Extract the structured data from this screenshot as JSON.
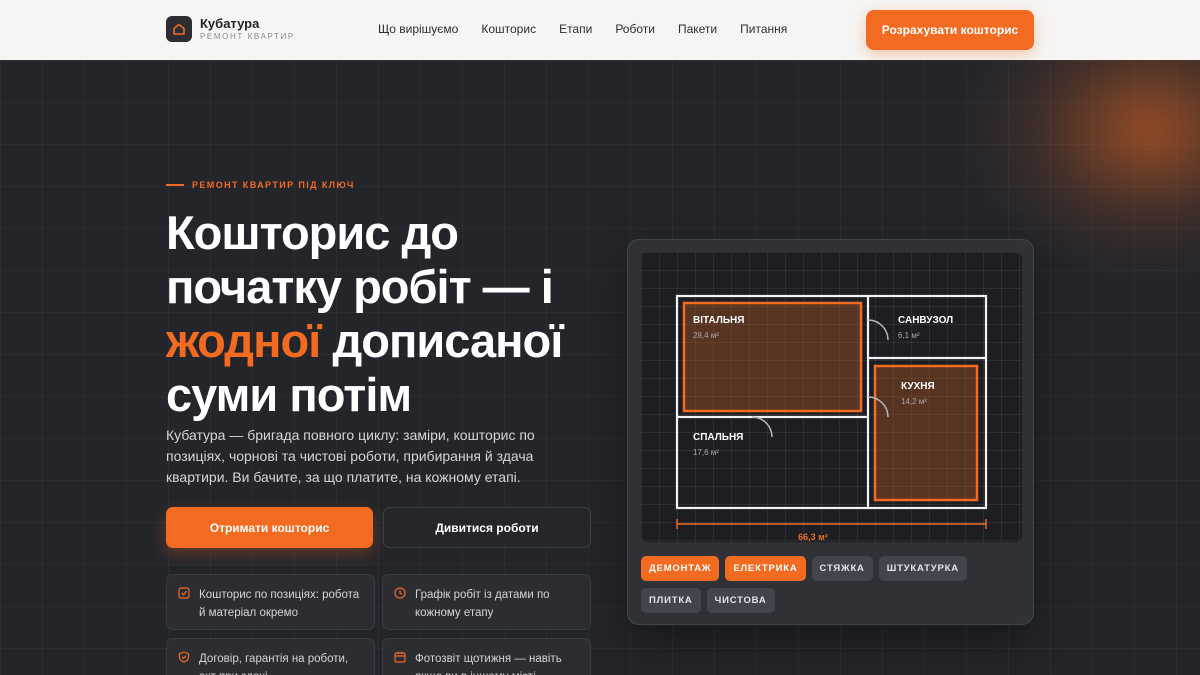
{
  "brand": {
    "name": "Кубатура",
    "tagline": "РЕМОНТ КВАРТИР"
  },
  "nav": {
    "items": [
      "Що вирішуємо",
      "Кошторис",
      "Етапи",
      "Роботи",
      "Пакети",
      "Питання"
    ]
  },
  "header_cta": "Розрахувати кошторис",
  "hero": {
    "eyebrow": "РЕМОНТ КВАРТИР ПІД КЛЮЧ",
    "headline_part1": "Кошторис до початку робіт — і ",
    "headline_accent": "жодної",
    "headline_part2": " дописаної суми потім",
    "lead": "Кубатура — бригада повного циклу: заміри, кошторис по позиціях, чорнові та чистові роботи, прибирання й здача квартири. Ви бачите, за що платите, на кожному етапі.",
    "primary_button": "Отримати кошторис",
    "secondary_button": "Дивитися роботи",
    "features": [
      {
        "icon": "checklist-icon",
        "text": "Кошторис по позиціях: робота й матеріал окремо"
      },
      {
        "icon": "clock-icon",
        "text": "Графік робіт із датами по кожному етапу"
      },
      {
        "icon": "shield-icon",
        "text": "Договір, гарантія на роботи, акт при здачі"
      },
      {
        "icon": "calendar-icon",
        "text": "Фотозвіт щотижня — навіть якщо ви в іншому місті"
      }
    ]
  },
  "plan": {
    "rooms": [
      {
        "name": "ВІТАЛЬНЯ",
        "area": "28,4 м²"
      },
      {
        "name": "САНВУЗОЛ",
        "area": "6,1 м²"
      },
      {
        "name": "КУХНЯ",
        "area": "14,2 м²"
      },
      {
        "name": "СПАЛЬНЯ",
        "area": "17,6 м²"
      }
    ],
    "total": "66,3 м²",
    "stages": [
      {
        "label": "ДЕМОНТАЖ",
        "active": true
      },
      {
        "label": "ЕЛЕКТРИКА",
        "active": true
      },
      {
        "label": "СТЯЖКА",
        "active": false
      },
      {
        "label": "ШТУКАТУРКА",
        "active": false
      },
      {
        "label": "ПЛИТКА",
        "active": false
      },
      {
        "label": "ЧИСТОВА",
        "active": false
      }
    ]
  },
  "colors": {
    "accent": "#f26b21",
    "bg": "#23252b",
    "header_bg": "#f6f5f3"
  }
}
